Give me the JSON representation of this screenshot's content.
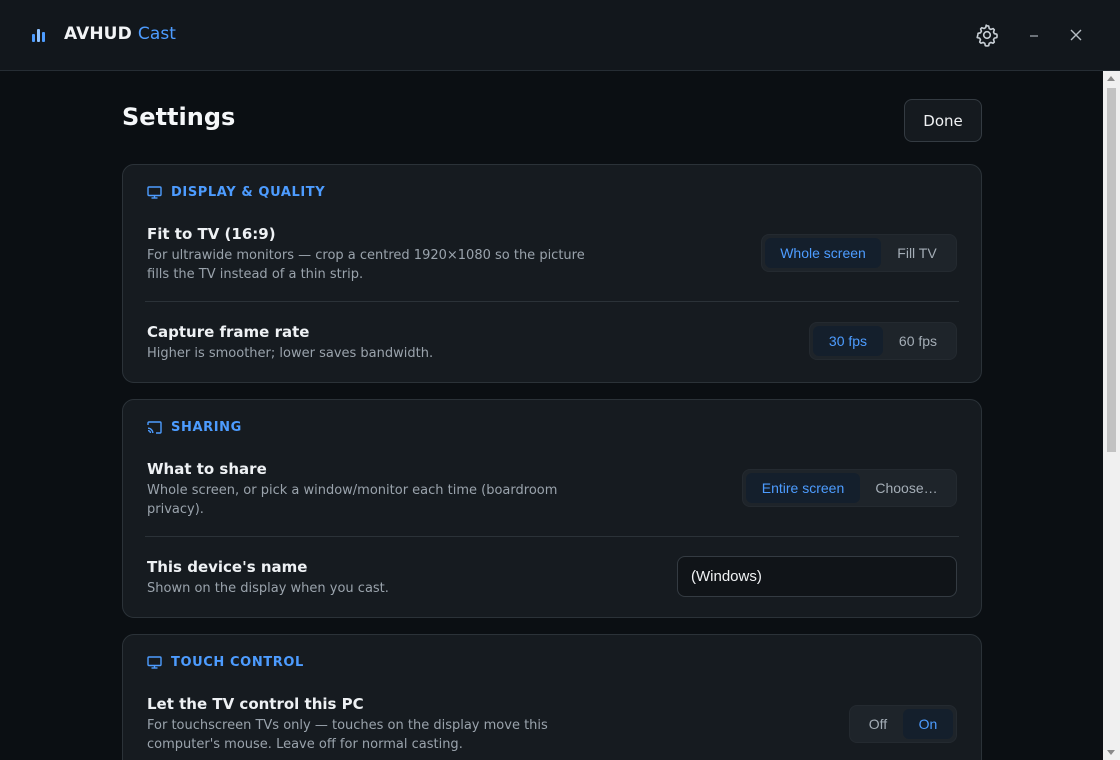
{
  "app": {
    "title_main": "AVHUD",
    "title_accent": "Cast"
  },
  "page": {
    "title": "Settings",
    "done_label": "Done"
  },
  "colors": {
    "accent": "#4d9cff",
    "background": "#0b0f13",
    "card": "#161b20"
  },
  "sections": {
    "display": {
      "heading": "DISPLAY & QUALITY",
      "icon": "monitor-icon",
      "fit": {
        "title": "Fit to TV (16:9)",
        "desc": "For ultrawide monitors — crop a centred 1920×1080 so the picture fills the TV instead of a thin strip.",
        "options": [
          "Whole screen",
          "Fill TV"
        ],
        "selected": "Whole screen"
      },
      "framerate": {
        "title": "Capture frame rate",
        "desc": "Higher is smoother; lower saves bandwidth.",
        "options": [
          "30 fps",
          "60 fps"
        ],
        "selected": "30 fps"
      }
    },
    "sharing": {
      "heading": "SHARING",
      "icon": "cast-icon",
      "what": {
        "title": "What to share",
        "desc": "Whole screen, or pick a window/monitor each time (boardroom privacy).",
        "options": [
          "Entire screen",
          "Choose…"
        ],
        "selected": "Entire screen"
      },
      "name": {
        "title": "This device's name",
        "desc": "Shown on the display when you cast.",
        "value": "(Windows)"
      }
    },
    "touch": {
      "heading": "TOUCH CONTROL",
      "icon": "monitor-icon",
      "control": {
        "title": "Let the TV control this PC",
        "desc": "For touchscreen TVs only — touches on the display move this computer's mouse. Leave off for normal casting.",
        "options": [
          "Off",
          "On"
        ],
        "selected": "On"
      }
    }
  }
}
